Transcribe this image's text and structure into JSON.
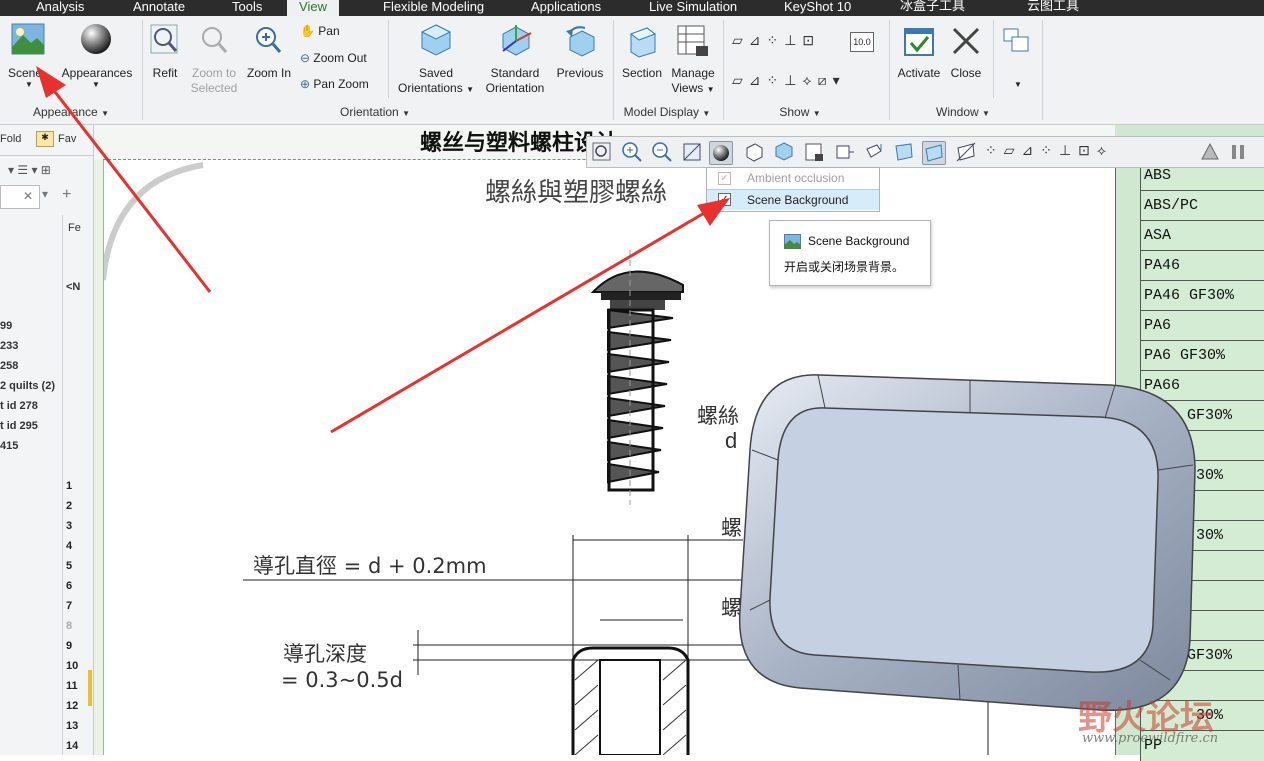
{
  "ribbon": {
    "tabs": [
      "Analysis",
      "Annotate",
      "Tools",
      "View",
      "Flexible Modeling",
      "Applications",
      "Live Simulation",
      "KeyShot 10",
      "冰盒子工具",
      "云图工具"
    ],
    "active_tab": "View",
    "appearance": {
      "scene": "Scene",
      "appearances": "Appearances",
      "group": "Appearance"
    },
    "orientation": {
      "refit": "Refit",
      "zoom_to_selected_1": "Zoom to",
      "zoom_to_selected_2": "Selected",
      "zoom_in": "Zoom In",
      "pan": "Pan",
      "zoom_out": "Zoom Out",
      "pan_zoom": "Pan Zoom",
      "saved_1": "Saved",
      "saved_2": "Orientations",
      "standard_1": "Standard",
      "standard_2": "Orientation",
      "previous": "Previous",
      "group": "Orientation"
    },
    "model_display": {
      "section": "Section",
      "manage_1": "Manage",
      "manage_2": "Views",
      "group": "Model Display"
    },
    "show": {
      "group": "Show",
      "readout": "10.0"
    },
    "window": {
      "activate": "Activate",
      "close": "Close",
      "group": "Window"
    }
  },
  "left_panel": {
    "tab_folders": "Fold",
    "tab_favorites": "Fav",
    "col_header": "Fe",
    "tree_items": [
      "<N",
      "99",
      "233",
      "258",
      "2 quilts (2)",
      "t id 278",
      "t id 295",
      "415"
    ],
    "line_numbers": [
      "1",
      "2",
      "3",
      "4",
      "5",
      "6",
      "7",
      "8",
      "9",
      "10",
      "11",
      "12",
      "13",
      "14"
    ]
  },
  "drawing": {
    "title": "螺丝与塑料螺柱设计",
    "subtitle": "螺絲與塑膠螺絲",
    "hole_diameter": "導孔直徑 = d + 0.2mm",
    "hole_depth_1": "導孔深度",
    "hole_depth_2": "= 0.3~0.5d",
    "screw_label": "螺絲",
    "d_label": "d",
    "side_1": "螺",
    "side_2": "螺"
  },
  "materials": [
    "ABS",
    "ABS/PC",
    "ASA",
    "PA46",
    "PA46 GF30%",
    "PA6",
    "PA6 GF30%",
    "PA66",
    "GF30%",
    "",
    "30%",
    "",
    "30%",
    "",
    "",
    "",
    "GF30%",
    "",
    "30%",
    "PP"
  ],
  "dropdown": {
    "ambient": "Ambient occlusion",
    "scene_bg": "Scene Background",
    "ambient_checked": true,
    "scene_bg_checked": true
  },
  "tooltip": {
    "title": "Scene Background",
    "desc": "开启或关闭场景背景。"
  },
  "watermark": {
    "cn": "野火论坛",
    "url": "www.proewildfire.cn"
  },
  "colors": {
    "accent_green": "#2a7a2a",
    "arrow_red": "#e8312f",
    "table_green": "#d4ecd4",
    "part_blue": "#c5d0e3"
  }
}
